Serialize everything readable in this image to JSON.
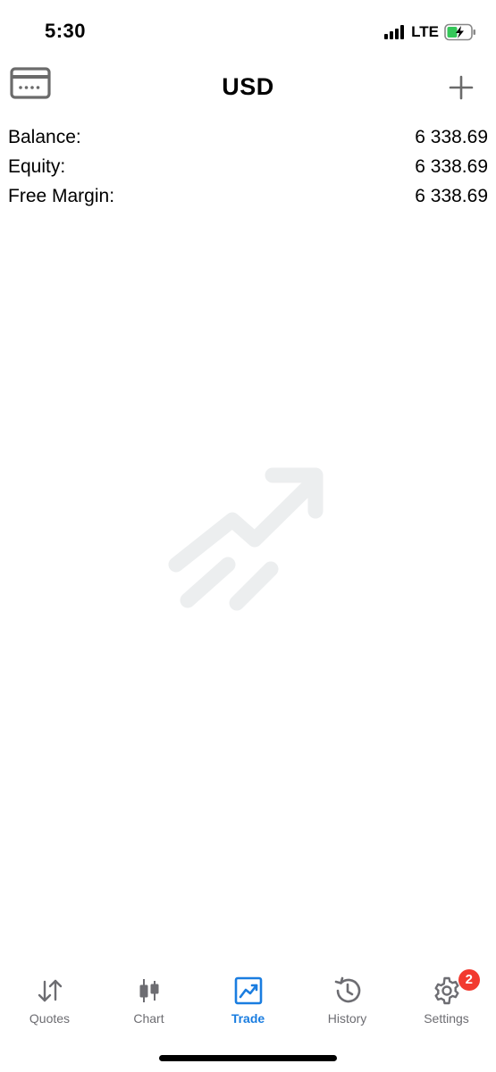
{
  "status_bar": {
    "time": "5:30",
    "network": "LTE",
    "battery_color": "#35c759"
  },
  "header": {
    "title": "USD",
    "left_icon": "card-icon",
    "right_icon": "plus-icon"
  },
  "summary": [
    {
      "label": "Balance:",
      "value": "6 338.69"
    },
    {
      "label": "Equity:",
      "value": "6 338.69"
    },
    {
      "label": "Free Margin:",
      "value": "6 338.69"
    }
  ],
  "empty_state": {
    "icon": "trend-up-icon"
  },
  "tabs": [
    {
      "label": "Quotes",
      "icon": "quotes-arrows-icon",
      "active": false
    },
    {
      "label": "Chart",
      "icon": "candlestick-icon",
      "active": false
    },
    {
      "label": "Trade",
      "icon": "trade-chart-icon",
      "active": true
    },
    {
      "label": "History",
      "icon": "history-clock-icon",
      "active": false
    },
    {
      "label": "Settings",
      "icon": "gear-icon",
      "active": false,
      "badge": "2"
    }
  ],
  "colors": {
    "accent": "#1a7de0",
    "inactive": "#6d6d72",
    "badge": "#f23a2f"
  }
}
